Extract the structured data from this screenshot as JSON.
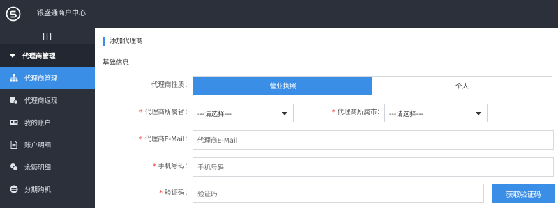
{
  "header": {
    "title": "银盛通商户中心",
    "logo_icon": "ys-logo-icon"
  },
  "sidebar": {
    "collapse_label": "|||",
    "group_label": "代理商管理",
    "items": [
      {
        "label": "代理商管理",
        "icon": "org-chart-icon",
        "active": true
      },
      {
        "label": "代理商返现",
        "icon": "cashback-icon",
        "active": false
      },
      {
        "label": "我的账户",
        "icon": "id-card-icon",
        "active": false
      },
      {
        "label": "账户明细",
        "icon": "document-icon",
        "active": false
      },
      {
        "label": "余额明细",
        "icon": "coins-icon",
        "active": false
      },
      {
        "label": "分期购机",
        "icon": "terminal-icon",
        "active": false
      }
    ]
  },
  "page": {
    "title": "添加代理商",
    "section": "基础信息"
  },
  "form": {
    "nature_label": "代理商性质：",
    "nature_options": [
      "营业执照",
      "个人"
    ],
    "nature_selected": "营业执照",
    "province_label": "代理商所属省：",
    "province_value": "---请选择---",
    "city_label": "代理商所属市：",
    "city_value": "---请选择---",
    "email_label": "代理商E-Mail：",
    "email_placeholder": "代理商E-Mail",
    "phone_label": "手机号码：",
    "phone_placeholder": "手机号码",
    "code_label": "验证码：",
    "code_placeholder": "验证码",
    "get_code_button": "获取验证码",
    "required_mark": "*"
  },
  "colors": {
    "accent": "#3a8ee6",
    "sidebar_bg": "#2b303b",
    "required": "#e33333"
  }
}
